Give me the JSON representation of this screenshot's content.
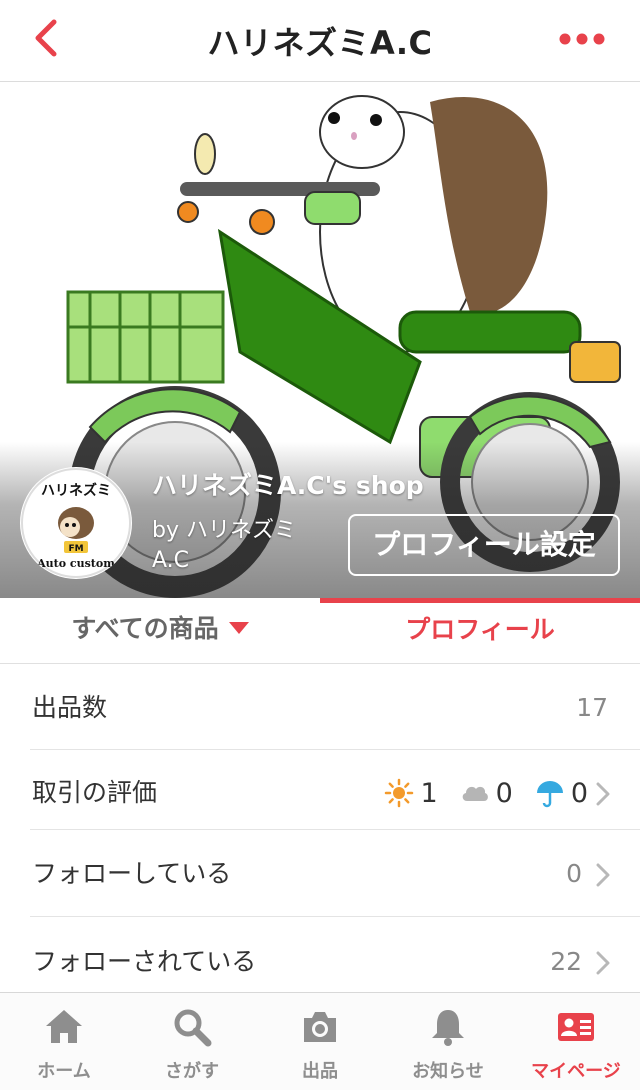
{
  "header": {
    "title": "ハリネズミA.C",
    "back_icon": "chevron-left-icon",
    "more_icon": "more-dots-icon",
    "accent_color": "#e8424b"
  },
  "hero": {
    "shop_name": "ハリネズミA.C's shop",
    "by_line": "by ハリネズミA.C",
    "profile_settings_label": "プロフィール設定",
    "avatar": {
      "line1": "ハリネズミ",
      "line2": "Auto custom",
      "badge": "FM"
    }
  },
  "tabs": {
    "all_items": "すべての商品",
    "profile": "プロフィール",
    "active": "profile"
  },
  "stats": {
    "listings": {
      "label": "出品数",
      "value": "17"
    },
    "rating": {
      "label": "取引の評価",
      "good": "1",
      "normal": "0",
      "bad": "0"
    },
    "following": {
      "label": "フォローしている",
      "value": "0"
    },
    "followers": {
      "label": "フォローされている",
      "value": "22"
    }
  },
  "bottom_nav": {
    "items": [
      {
        "label": "ホーム",
        "icon": "home-icon"
      },
      {
        "label": "さがす",
        "icon": "search-icon"
      },
      {
        "label": "出品",
        "icon": "camera-icon"
      },
      {
        "label": "お知らせ",
        "icon": "bell-icon"
      },
      {
        "label": "マイページ",
        "icon": "profile-card-icon"
      }
    ],
    "active_index": 4,
    "inactive_color": "#8e8e8e"
  }
}
